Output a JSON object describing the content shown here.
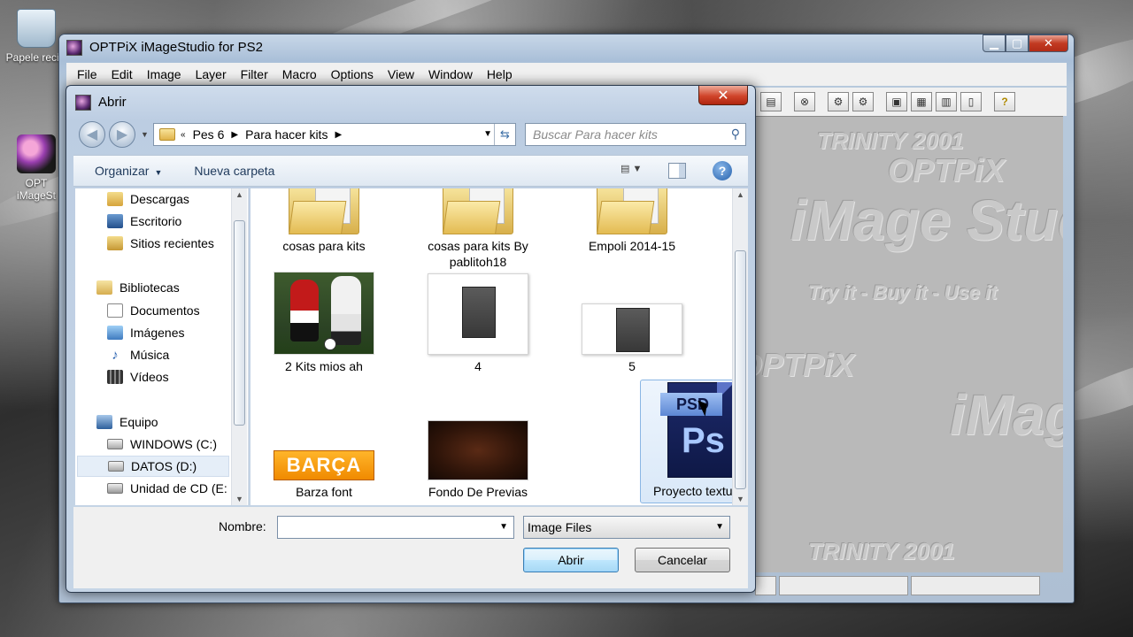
{
  "desktop": {
    "icons": [
      {
        "label": "Papele recicl"
      },
      {
        "label": "OPT iMageSt"
      }
    ]
  },
  "main_window": {
    "title": "OPTPiX iMageStudio for PS2",
    "menu": [
      "File",
      "Edit",
      "Image",
      "Layer",
      "Filter",
      "Macro",
      "Options",
      "View",
      "Window",
      "Help"
    ],
    "watermark": {
      "trinity": "TRINITY 2001",
      "optpix": "OPTPiX",
      "imagestudio": "iMage Studio",
      "tagline": "Try it - Buy it - Use it"
    }
  },
  "dialog": {
    "title": "Abrir",
    "close_label": "✕",
    "breadcrumb": [
      "Pes 6",
      "Para hacer kits"
    ],
    "search_placeholder": "Buscar Para hacer kits",
    "organize_label": "Organizar",
    "new_folder_label": "Nueva carpeta",
    "nav_items": [
      {
        "label": "Descargas",
        "icon": "downloads-icon"
      },
      {
        "label": "Escritorio",
        "icon": "desktop-icon"
      },
      {
        "label": "Sitios recientes",
        "icon": "recent-places-icon"
      },
      {
        "label": "Bibliotecas",
        "icon": "libraries-icon"
      },
      {
        "label": "Documentos",
        "icon": "documents-icon"
      },
      {
        "label": "Imágenes",
        "icon": "pictures-icon"
      },
      {
        "label": "Música",
        "icon": "music-icon"
      },
      {
        "label": "Vídeos",
        "icon": "videos-icon"
      },
      {
        "label": "Equipo",
        "icon": "computer-icon"
      },
      {
        "label": "WINDOWS (C:)",
        "icon": "drive-icon"
      },
      {
        "label": "DATOS (D:)",
        "icon": "drive-icon",
        "selected": true
      },
      {
        "label": "Unidad de CD (E:",
        "icon": "cd-drive-icon"
      }
    ],
    "files": [
      {
        "name": "cosas para kits",
        "type": "folder"
      },
      {
        "name": "cosas para kits By pablitoh18",
        "type": "folder"
      },
      {
        "name": "Empoli 2014-15",
        "type": "folder"
      },
      {
        "name": "2 Kits mios ah",
        "type": "photo"
      },
      {
        "name": "4",
        "type": "image"
      },
      {
        "name": "5",
        "type": "image"
      },
      {
        "name": "Barza font",
        "type": "image",
        "thumb_text": "BARÇA"
      },
      {
        "name": "Fondo De Previas",
        "type": "image"
      },
      {
        "name": "Proyecto textura",
        "type": "psd",
        "selected": true,
        "thumb_text": "PSD",
        "logo_text": "Ps"
      }
    ],
    "filename_label": "Nombre:",
    "filename_value": "",
    "filter_value": "Image Files",
    "open_button": "Abrir",
    "cancel_button": "Cancelar"
  }
}
